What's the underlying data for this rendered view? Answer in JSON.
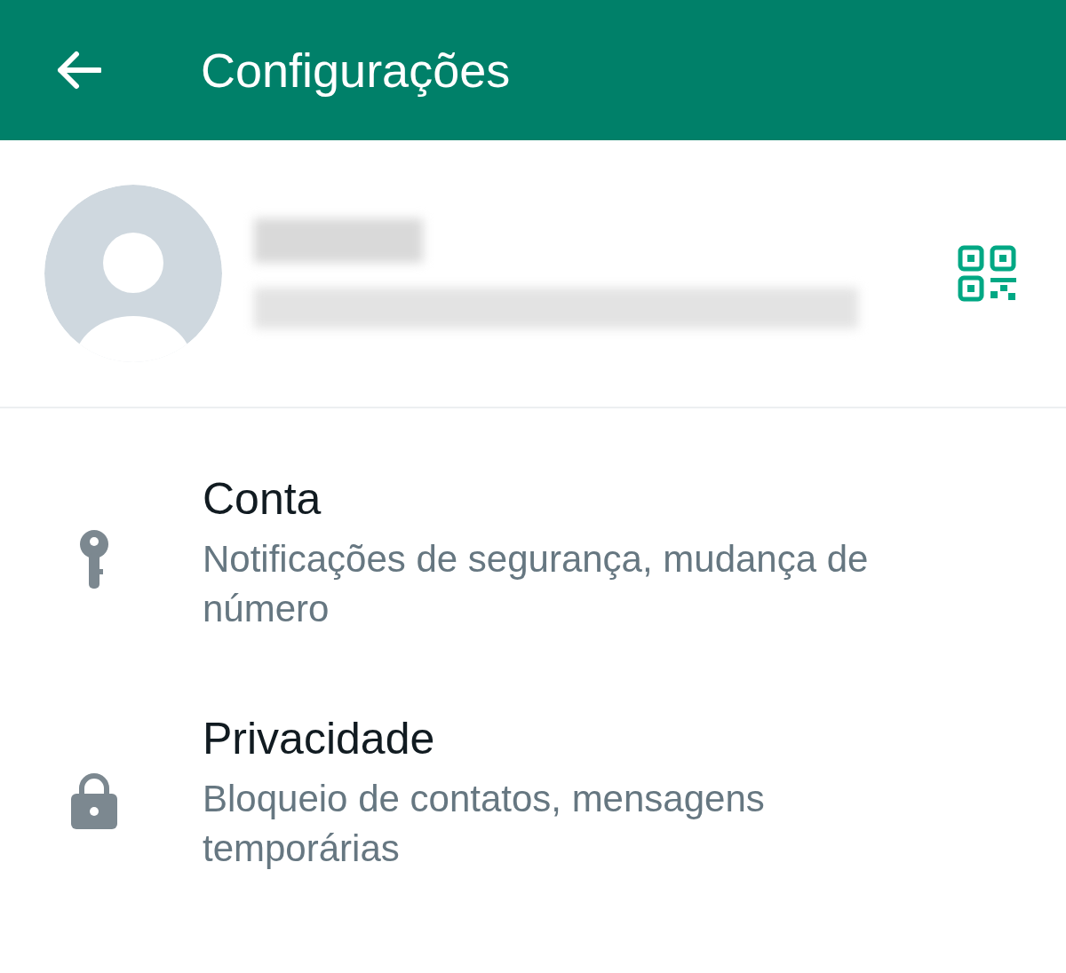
{
  "header": {
    "title": "Configurações"
  },
  "settings": [
    {
      "kind": "key",
      "title": "Conta",
      "subtitle": "Notificações de segurança, mudança de número"
    },
    {
      "kind": "lock",
      "title": "Privacidade",
      "subtitle": "Bloqueio de contatos, mensagens temporárias"
    }
  ]
}
